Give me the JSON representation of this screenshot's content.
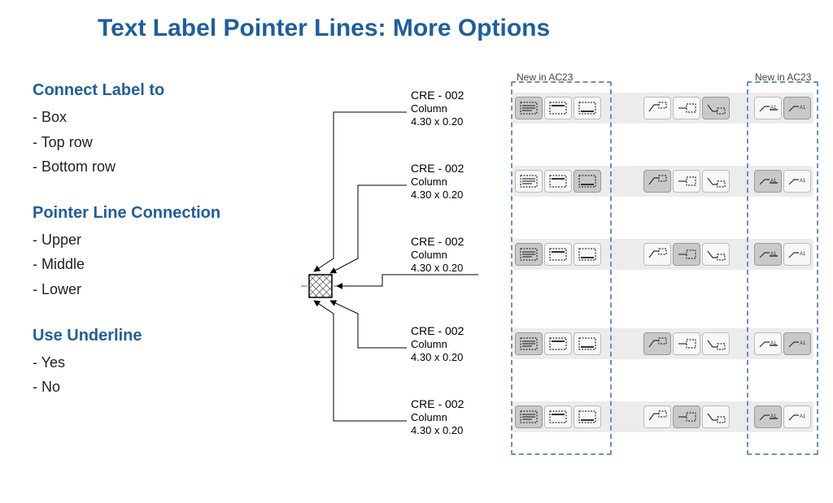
{
  "title": "Text Label Pointer Lines: More Options",
  "new_badge": "New in AC23",
  "left": {
    "sections": [
      {
        "heading": "Connect Label to",
        "options": [
          "Box",
          "Top row",
          "Bottom row"
        ]
      },
      {
        "heading": "Pointer Line Connection",
        "options": [
          "Upper",
          "Middle",
          "Lower"
        ]
      },
      {
        "heading": "Use Underline",
        "options": [
          "Yes",
          "No"
        ]
      }
    ]
  },
  "labels": [
    {
      "line1": "CRE - 002",
      "line2": "Column",
      "line3": "4.30 x 0.20",
      "underline": false
    },
    {
      "line1": "CRE - 002",
      "line2": "Column",
      "line3": "4.30 x 0.20",
      "underline": false
    },
    {
      "line1": "CRE - 002",
      "line2": "Column",
      "line3": "4.30 x 0.20",
      "underline": true
    },
    {
      "line1": "CRE - 002",
      "line2": "Column",
      "line3": "4.30 x 0.20",
      "underline": false
    },
    {
      "line1": "CRE - 002",
      "line2": "Column",
      "line3": "4.30 x 0.20",
      "underline": false
    }
  ],
  "panel_rows": [
    {
      "g1_sel": 0,
      "g2": [
        "upper",
        "middle",
        "lower"
      ],
      "g2_sel": 2,
      "g3": [
        "yes",
        "no"
      ],
      "g3_sel": 1
    },
    {
      "g1_sel": 2,
      "g2": [
        "upper",
        "middle",
        "lower"
      ],
      "g2_sel": 0,
      "g3": [
        "yes",
        "no"
      ],
      "g3_sel": 0
    },
    {
      "g1_sel": 0,
      "g2": [
        "upper",
        "middle",
        "lower"
      ],
      "g2_sel": 1,
      "g3": [
        "yes",
        "no"
      ],
      "g3_sel": 0
    },
    {
      "g1_sel": 0,
      "g2": [
        "upper",
        "middle",
        "lower"
      ],
      "g2_sel": 0,
      "g3": [
        "yes",
        "no"
      ],
      "g3_sel": 1
    },
    {
      "g1_sel": 0,
      "g2": [
        "upper",
        "middle",
        "lower"
      ],
      "g2_sel": 1,
      "g3": [
        "yes",
        "no"
      ],
      "g3_sel": 0
    }
  ]
}
